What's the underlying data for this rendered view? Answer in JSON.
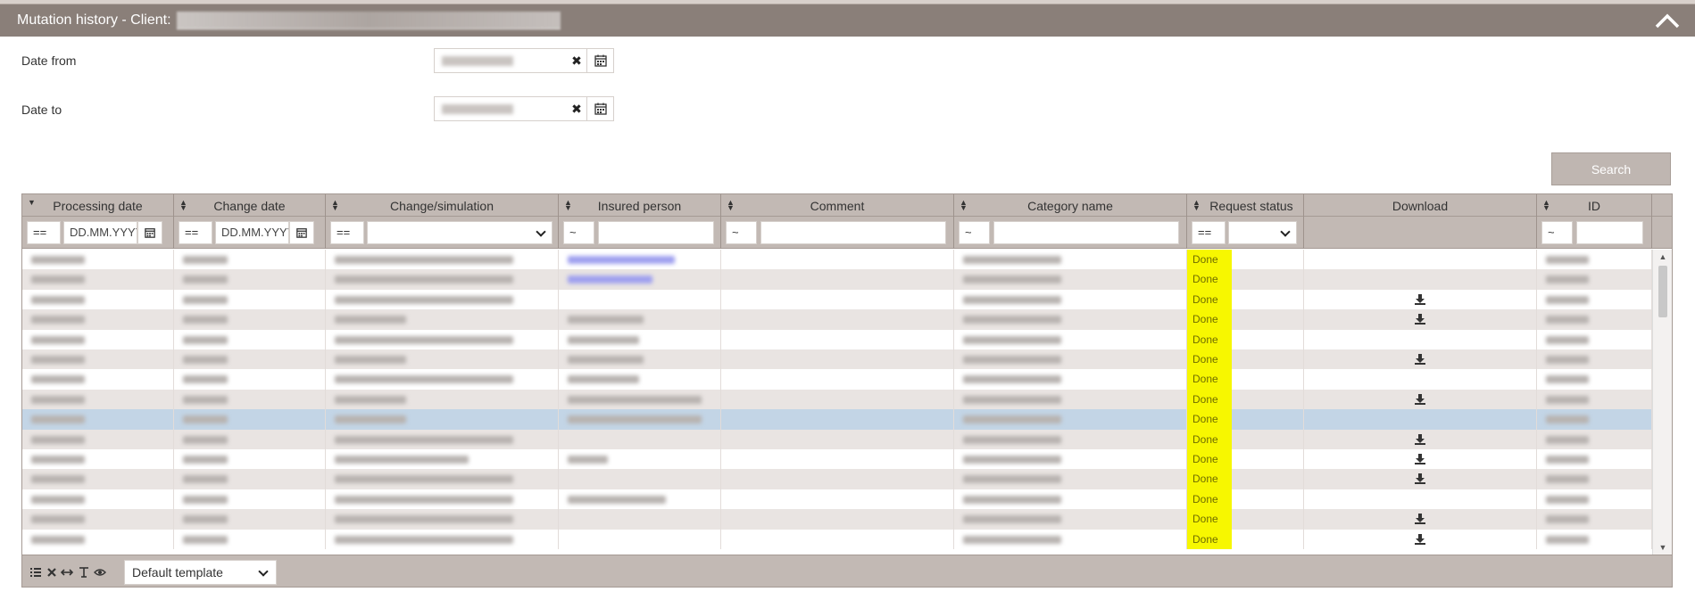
{
  "header": {
    "title": "Mutation history - Client:"
  },
  "form": {
    "date_from_label": "Date from",
    "date_to_label": "Date to",
    "search_label": "Search"
  },
  "columns": [
    {
      "label": "Processing date",
      "sort": "desc"
    },
    {
      "label": "Change date",
      "sort": "both"
    },
    {
      "label": "Change/simulation",
      "sort": "both"
    },
    {
      "label": "Insured person",
      "sort": "both"
    },
    {
      "label": "Comment",
      "sort": "both"
    },
    {
      "label": "Category name",
      "sort": "both"
    },
    {
      "label": "Request status",
      "sort": "both"
    },
    {
      "label": "Download",
      "sort": ""
    },
    {
      "label": "ID",
      "sort": "both"
    }
  ],
  "filters": {
    "processing_op": "==",
    "processing_placeholder": "DD.MM.YYYY",
    "change_op": "==",
    "change_placeholder": "DD.MM.YYYY",
    "simulation_op": "==",
    "insured_op": "~",
    "comment_op": "~",
    "category_op": "~",
    "status_op": "==",
    "id_op": "~"
  },
  "rows": [
    {
      "status": "Done",
      "download": false,
      "insured_link": true
    },
    {
      "status": "Done",
      "download": false,
      "insured_link": true
    },
    {
      "status": "Done",
      "download": true,
      "insured_link": false
    },
    {
      "status": "Done",
      "download": true,
      "insured_link": false
    },
    {
      "status": "Done",
      "download": false,
      "insured_link": false
    },
    {
      "status": "Done",
      "download": true,
      "insured_link": false
    },
    {
      "status": "Done",
      "download": false,
      "insured_link": false
    },
    {
      "status": "Done",
      "download": true,
      "insured_link": false
    },
    {
      "status": "Done",
      "download": false,
      "insured_link": false,
      "selected": true
    },
    {
      "status": "Done",
      "download": true,
      "insured_link": false
    },
    {
      "status": "Done",
      "download": true,
      "insured_link": false
    },
    {
      "status": "Done",
      "download": true,
      "insured_link": false
    },
    {
      "status": "Done",
      "download": false,
      "insured_link": false
    },
    {
      "status": "Done",
      "download": true,
      "insured_link": false
    },
    {
      "status": "Done",
      "download": true,
      "insured_link": false
    }
  ],
  "footer": {
    "template_label": "Default template"
  },
  "colors": {
    "header_bg": "#8a7f79",
    "grid_header_bg": "#c2b9b4",
    "status_highlight": "#f7f700",
    "selected_row": "#c3d5e6"
  },
  "icons": [
    "chevron-up-icon",
    "clear-icon",
    "calendar-icon",
    "sort-icon",
    "download-icon",
    "list-icon",
    "close-icon",
    "resize-icon",
    "text-icon",
    "eye-icon"
  ]
}
